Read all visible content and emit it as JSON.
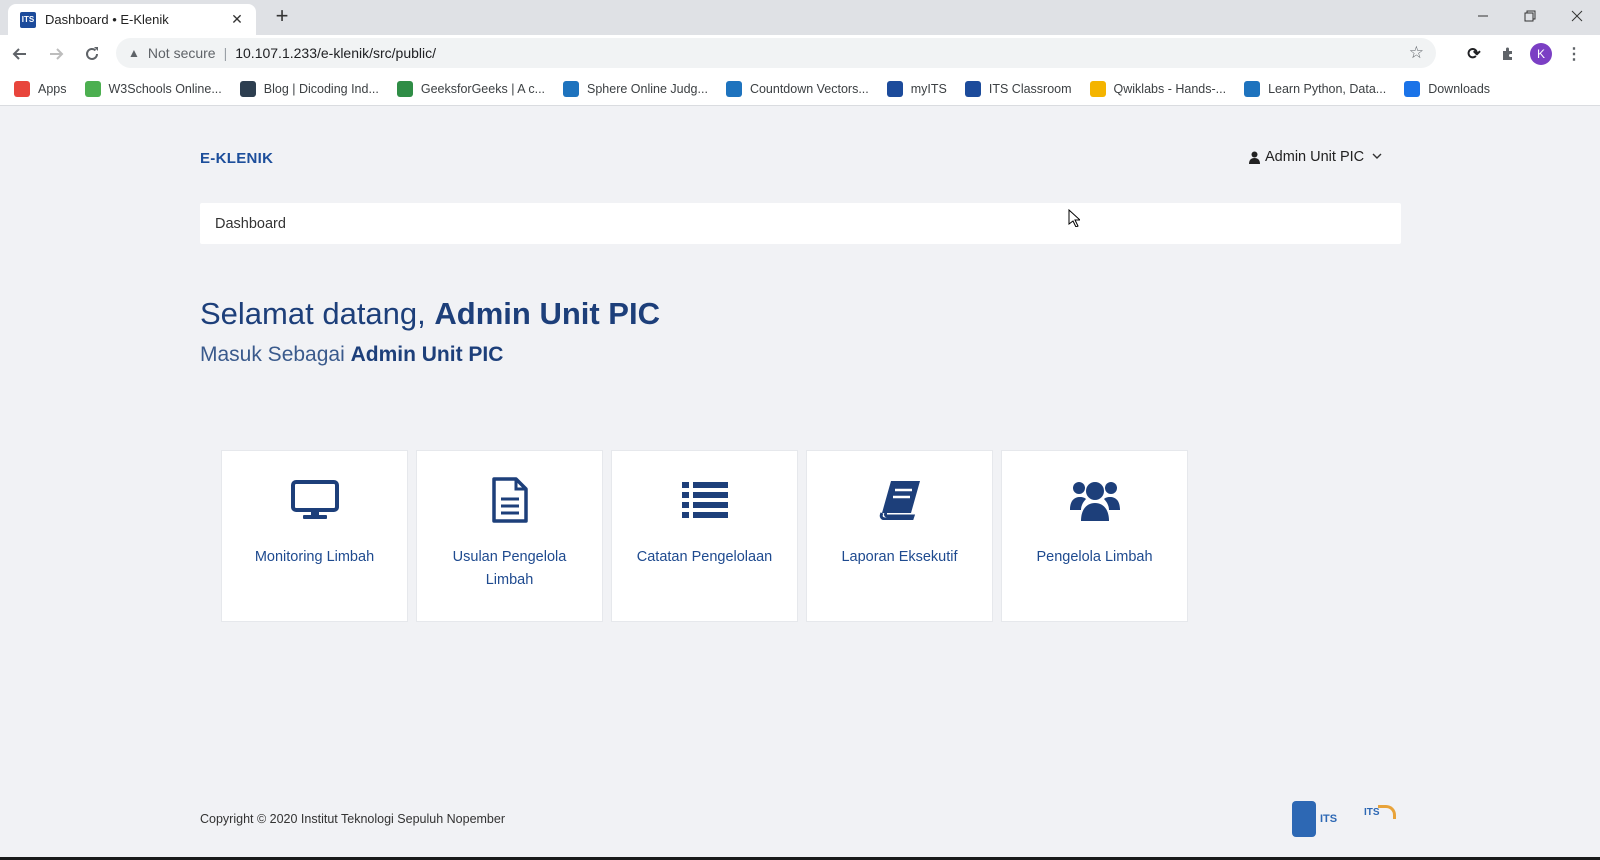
{
  "browser": {
    "tab_title": "Dashboard • E-Klenik",
    "tab_favicon": "ITS",
    "security_label": "Not secure",
    "url": "10.107.1.233/e-klenik/src/public/",
    "profile_initial": "K",
    "bookmarks": [
      {
        "label": "Apps",
        "icon": "apps-grid-icon",
        "color": "#e8453c"
      },
      {
        "label": "W3Schools Online...",
        "icon": "w3schools-icon",
        "color": "#4caf50"
      },
      {
        "label": "Blog | Dicoding Ind...",
        "icon": "dicoding-icon",
        "color": "#2d3e50"
      },
      {
        "label": "GeeksforGeeks | A c...",
        "icon": "gfg-icon",
        "color": "#2f8d46"
      },
      {
        "label": "Sphere Online Judg...",
        "icon": "spoj-icon",
        "color": "#1e73be"
      },
      {
        "label": "Countdown Vectors...",
        "icon": "countdown-icon",
        "color": "#1e73be"
      },
      {
        "label": "myITS",
        "icon": "myits-icon",
        "color": "#1c4b9b"
      },
      {
        "label": "ITS Classroom",
        "icon": "its-classroom-icon",
        "color": "#1c4b9b"
      },
      {
        "label": "Qwiklabs - Hands-...",
        "icon": "qwiklabs-icon",
        "color": "#f4b400"
      },
      {
        "label": "Learn Python, Data...",
        "icon": "kaggle-icon",
        "color": "#1e73be"
      },
      {
        "label": "Downloads",
        "icon": "download-icon",
        "color": "#1a73e8"
      }
    ]
  },
  "header": {
    "brand": "E-KLENIK",
    "user_name": "Admin Unit PIC"
  },
  "breadcrumb": {
    "current": "Dashboard"
  },
  "welcome": {
    "greeting": "Selamat datang,",
    "name": "Admin Unit PIC",
    "role_prefix": "Masuk Sebagai",
    "role": "Admin Unit PIC"
  },
  "menu": [
    {
      "label": "Monitoring Limbah",
      "icon": "monitor-icon"
    },
    {
      "label": "Usulan Pengelola Limbah",
      "icon": "document-icon"
    },
    {
      "label": "Catatan Pengelolaan",
      "icon": "list-icon"
    },
    {
      "label": "Laporan Eksekutif",
      "icon": "book-icon"
    },
    {
      "label": "Pengelola Limbah",
      "icon": "users-icon"
    }
  ],
  "footer": {
    "copyright": "Copyright © 2020 Institut Teknologi Sepuluh Nopember"
  },
  "theme": {
    "primary": "#1c4e9b",
    "heading": "#1d3f7a",
    "page_bg": "#f1f2f5"
  }
}
